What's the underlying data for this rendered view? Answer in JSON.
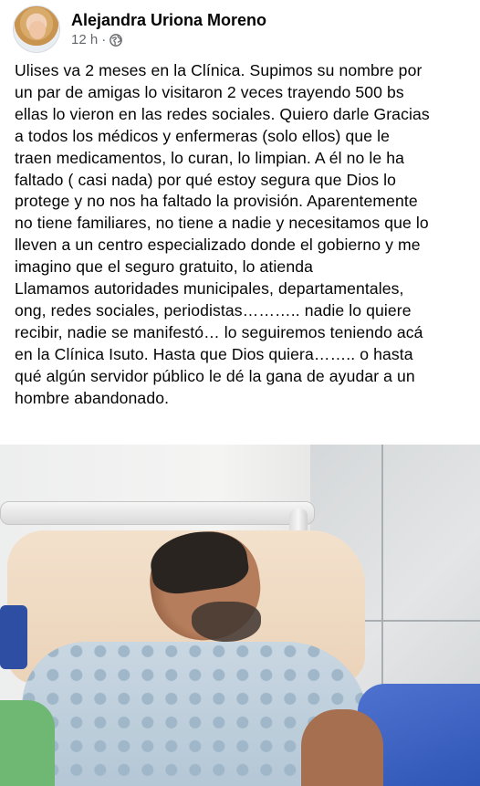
{
  "post": {
    "author": "Alejandra Uriona Moreno",
    "time": "12 h",
    "separator": "·",
    "audience_icon": "globe-icon",
    "text_lines": [
      "Ulises va 2 meses en la Clínica. Supimos su nombre por",
      "un par de amigas lo visitaron 2 veces trayendo 500 bs",
      "ellas lo vieron en las redes sociales. Quiero darle Gracias",
      "a todos los médicos y enfermeras (solo ellos) que le",
      "traen medicamentos, lo curan, lo limpian. A él no le ha",
      "faltado ( casi nada) por qué estoy segura que Dios lo",
      "protege y no nos ha faltado la provisión.  Aparentemente",
      "no tiene familiares, no tiene a nadie y necesitamos que lo",
      "lleven a un centro especializado donde el gobierno y me",
      "imagino que el seguro gratuito, lo atienda",
      "Llamamos autoridades municipales, departamentales,",
      "ong, redes sociales, periodistas………..  nadie lo quiere",
      "recibir, nadie se manifestó… lo seguiremos teniendo acá",
      "en la Clínica Isuto. Hasta que Dios quiera…….. o hasta",
      "qué algún servidor público le dé la gana de ayudar a un",
      "hombre abandonado."
    ]
  },
  "colors": {
    "text": "#050505",
    "secondary": "#65676b",
    "background": "#ffffff"
  }
}
